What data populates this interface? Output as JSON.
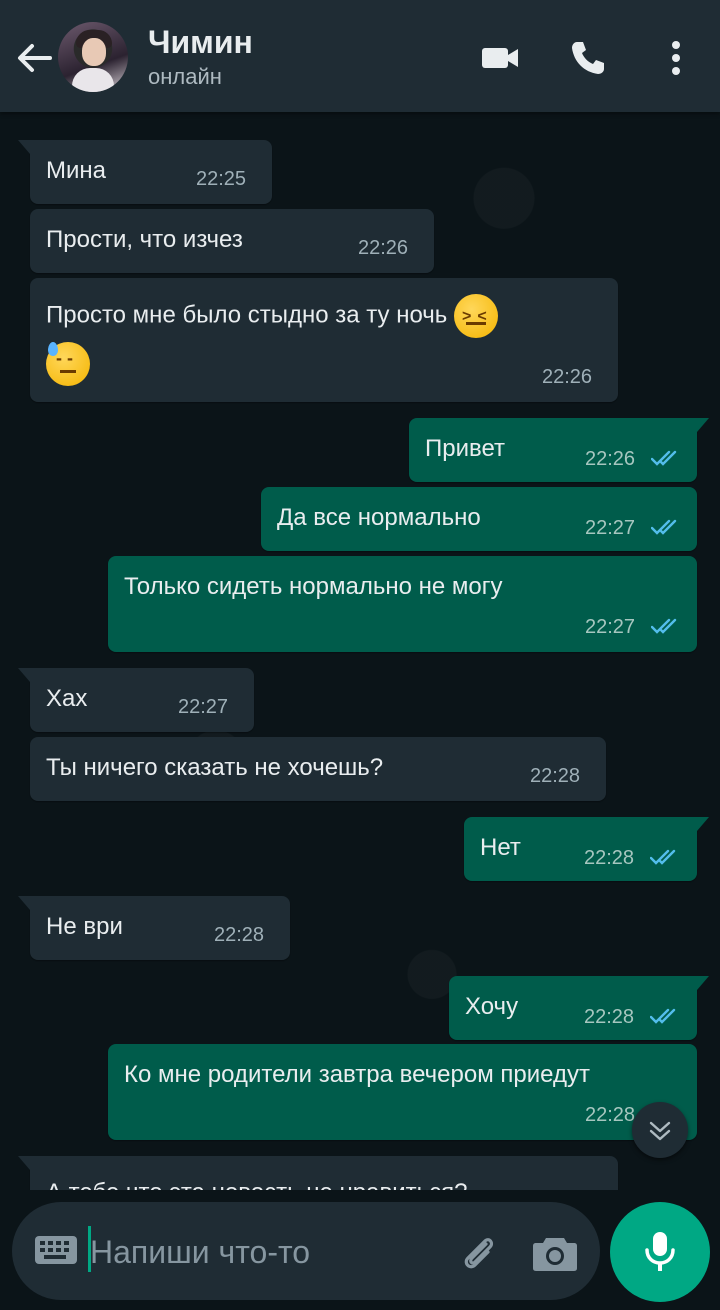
{
  "header": {
    "name": "Чимин",
    "status": "онлайн"
  },
  "messages": [
    {
      "dir": "in",
      "text": "Мина",
      "time": "22:25"
    },
    {
      "dir": "in",
      "text": "Прости, что изчез",
      "time": "22:26"
    },
    {
      "dir": "in",
      "text": "Просто мне было стыдно за ту ночь",
      "emoji": [
        "confounded-face",
        "downcast-face-with-sweat"
      ],
      "time": "22:26"
    },
    {
      "dir": "out",
      "text": "Привет",
      "time": "22:26",
      "read": true
    },
    {
      "dir": "out",
      "text": "Да все нормально",
      "time": "22:27",
      "read": true
    },
    {
      "dir": "out",
      "text": "Только сидеть нормально не могу",
      "time": "22:27",
      "read": true
    },
    {
      "dir": "in",
      "text": "Хах",
      "time": "22:27"
    },
    {
      "dir": "in",
      "text": "Ты ничего сказать не хочешь?",
      "time": "22:28"
    },
    {
      "dir": "out",
      "text": "Нет",
      "time": "22:28",
      "read": true
    },
    {
      "dir": "in",
      "text": "Не ври",
      "time": "22:28"
    },
    {
      "dir": "out",
      "text": "Хочу",
      "time": "22:28",
      "read": true
    },
    {
      "dir": "out",
      "text": "Ко мне родители завтра вечером приедут",
      "time": "22:28",
      "read": true
    },
    {
      "dir": "in",
      "text": "А тебе что эта новость не нравиться?",
      "time": ""
    }
  ],
  "composer": {
    "placeholder": "Напиши что-то"
  },
  "colors": {
    "accent": "#00a884",
    "outgoing_bubble": "#005c4b",
    "incoming_bubble": "#1f2c34",
    "read_ticks": "#53bdeb"
  }
}
